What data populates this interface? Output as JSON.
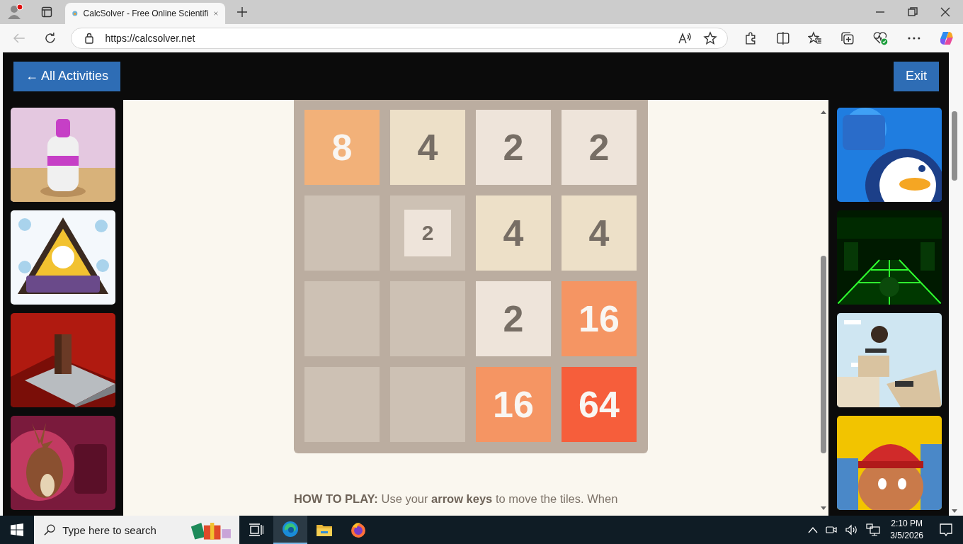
{
  "browser": {
    "tabs": [
      {
        "title": "CalcSolver - Free Online Scientifi",
        "selected": true
      }
    ],
    "url": "https://calcsolver.net"
  },
  "header": {
    "back_button": "← All Activities",
    "exit_button": "Exit"
  },
  "board": [
    [
      {
        "kind": "tile",
        "value": "8",
        "color": "#f2b179"
      },
      {
        "kind": "tile",
        "value": "4",
        "color": "#ede0c8"
      },
      {
        "kind": "tile",
        "value": "2",
        "color": "#eee4da"
      },
      {
        "kind": "tile",
        "value": "2",
        "color": "#eee4da"
      }
    ],
    [
      {
        "kind": "empty"
      },
      {
        "kind": "new",
        "value": "2",
        "color": "#eee4da"
      },
      {
        "kind": "tile",
        "value": "4",
        "color": "#ede0c8"
      },
      {
        "kind": "tile",
        "value": "4",
        "color": "#ede0c8"
      }
    ],
    [
      {
        "kind": "empty"
      },
      {
        "kind": "empty"
      },
      {
        "kind": "tile",
        "value": "2",
        "color": "#eee4da"
      },
      {
        "kind": "tile",
        "value": "16",
        "color": "#f59563"
      }
    ],
    [
      {
        "kind": "empty"
      },
      {
        "kind": "empty"
      },
      {
        "kind": "tile",
        "value": "16",
        "color": "#f59563"
      },
      {
        "kind": "tile",
        "value": "64",
        "color": "#f65e3b"
      }
    ]
  ],
  "instructions": "**HOW TO PLAY:** Use your **arrow keys** to move the tiles. When",
  "taskbar": {
    "search_placeholder": "Type here to search",
    "time": "2:10 PM",
    "date": "3/5/2026"
  }
}
